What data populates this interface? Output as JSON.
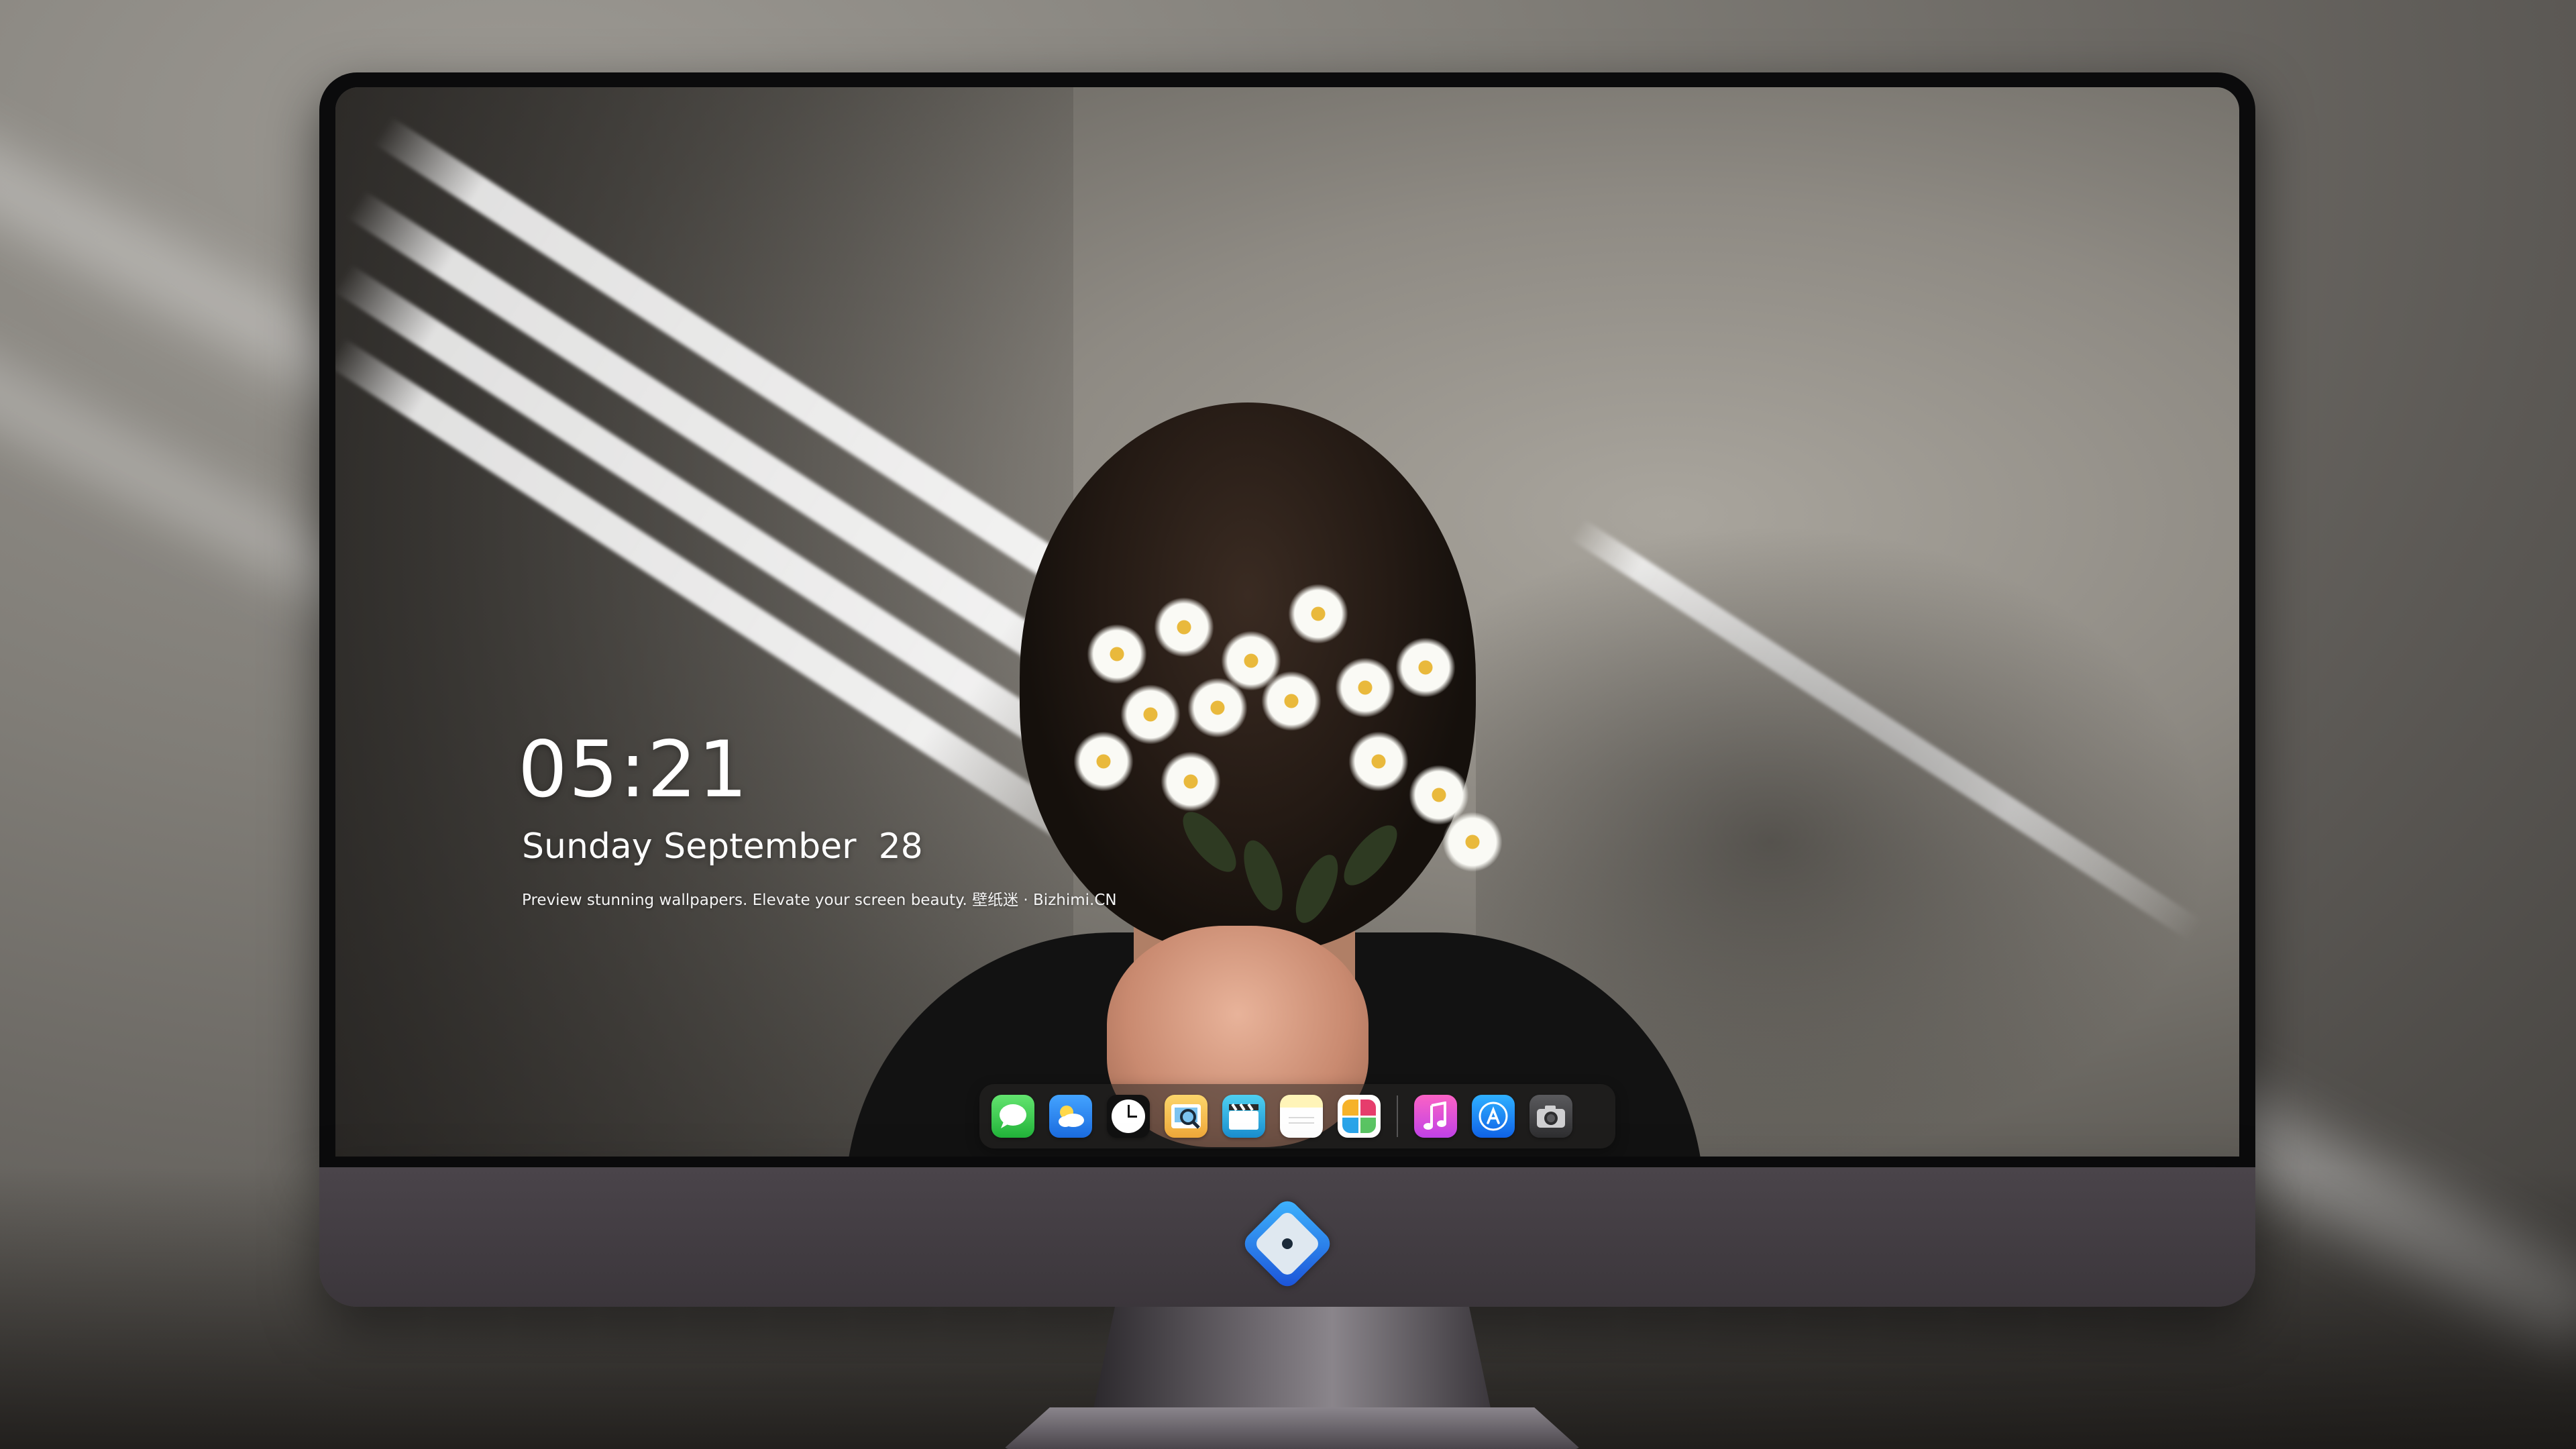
{
  "lockscreen": {
    "time": "05:21",
    "date": "Sunday September  28",
    "caption": "Preview stunning wallpapers. Elevate your screen beauty. 壁纸迷 · Bizhimi.CN"
  },
  "dock": {
    "items": [
      {
        "id": "messages",
        "icon": "messages-icon"
      },
      {
        "id": "weather",
        "icon": "weather-icon"
      },
      {
        "id": "clock",
        "icon": "clock-icon"
      },
      {
        "id": "preview",
        "icon": "preview-icon"
      },
      {
        "id": "clips",
        "icon": "clips-icon"
      },
      {
        "id": "notes",
        "icon": "notes-icon"
      },
      {
        "id": "photos",
        "icon": "photos-icon"
      },
      {
        "id": "music",
        "icon": "music-icon"
      },
      {
        "id": "appstore",
        "icon": "app-store-icon"
      },
      {
        "id": "camera",
        "icon": "camera-icon"
      }
    ]
  },
  "colors": {
    "bezel": "#0b0b0c",
    "chin": "#4a444a",
    "text": "#ffffff"
  }
}
